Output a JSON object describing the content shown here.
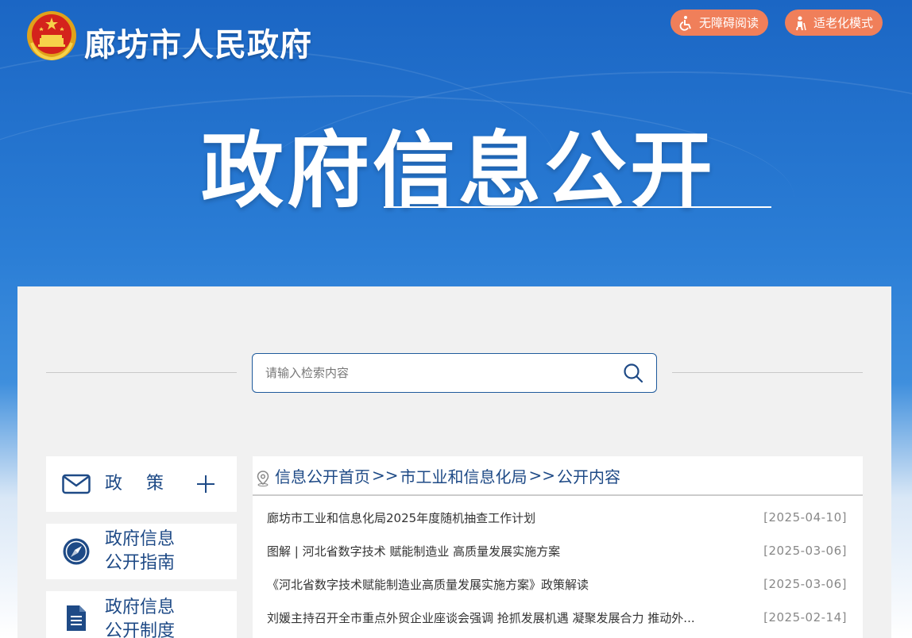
{
  "header": {
    "site_name": "廊坊市人民政府",
    "accessibility_label": "无障碍阅读",
    "elder_mode_label": "适老化模式"
  },
  "hero": {
    "title": "政府信息公开"
  },
  "search": {
    "placeholder": "请输入检索内容"
  },
  "sidebar": {
    "items": [
      {
        "label": "政策",
        "icon": "envelope-icon"
      },
      {
        "label": "政府信息\n公开指南",
        "icon": "compass-icon"
      },
      {
        "label": "政府信息\n公开制度",
        "icon": "document-icon"
      }
    ]
  },
  "breadcrumb": {
    "home": "信息公开首页",
    "sep": ">>",
    "dept": "市工业和信息化局",
    "current": "公开内容"
  },
  "news": [
    {
      "title": "廊坊市工业和信息化局2025年度随机抽查工作计划",
      "date": "[2025-04-10]"
    },
    {
      "title": "图解 | 河北省数字技术 赋能制造业 高质量发展实施方案",
      "date": "[2025-03-06]"
    },
    {
      "title": "《河北省数字技术赋能制造业高质量发展实施方案》政策解读",
      "date": "[2025-03-06]"
    },
    {
      "title": "刘媛主持召开全市重点外贸企业座谈会强调 抢抓发展机遇 凝聚发展合力 推动外...",
      "date": "[2025-02-14]"
    }
  ],
  "colors": {
    "primary_blue": "#1e4a86",
    "accent_orange": "#f07f5a"
  }
}
